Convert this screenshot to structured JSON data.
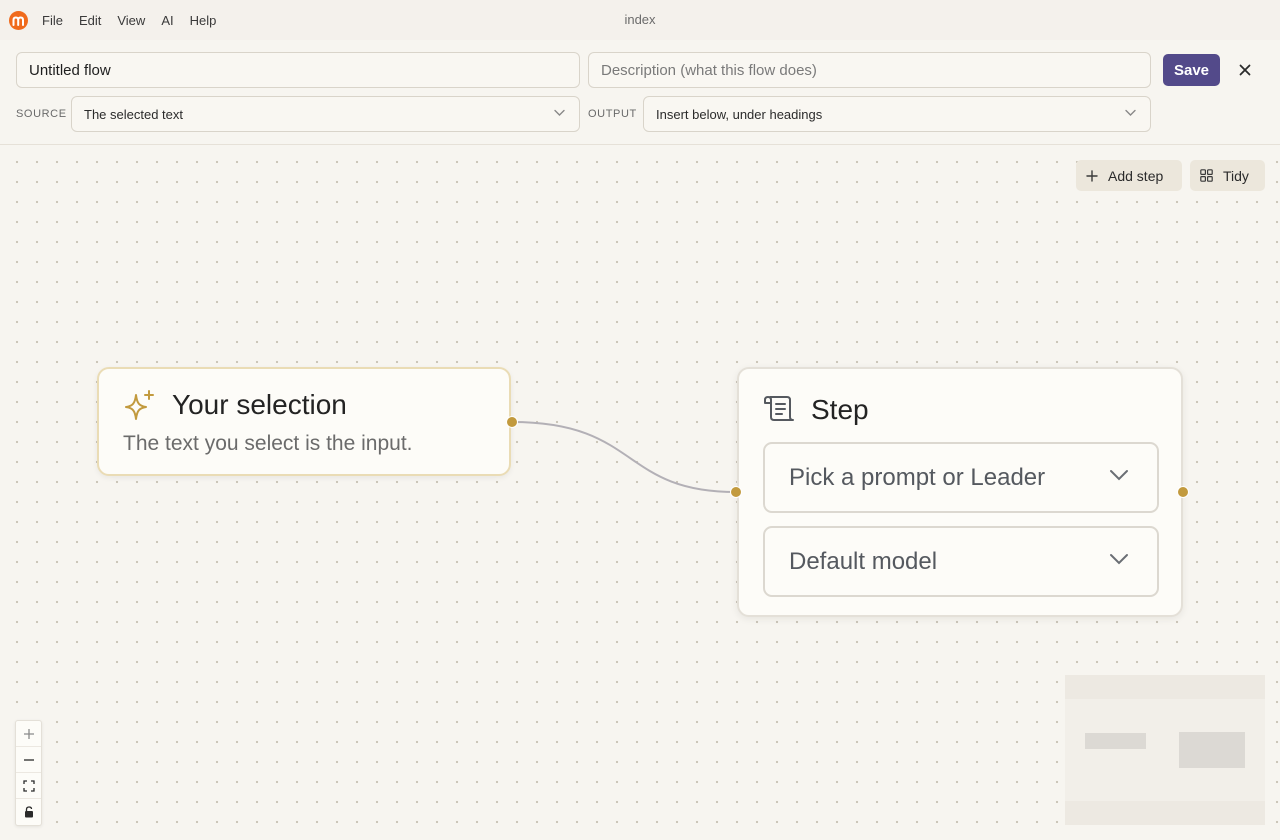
{
  "menubar": {
    "items": [
      "File",
      "Edit",
      "View",
      "AI",
      "Help"
    ],
    "window_title": "index",
    "logo_icon": "m-logo-icon",
    "logo_color": "#f06a1c"
  },
  "form": {
    "title_value": "Untitled flow",
    "description_placeholder": "Description (what this flow does)",
    "save_label": "Save",
    "close_icon": "close-icon",
    "source_label": "SOURCE",
    "source_value": "The selected text",
    "output_label": "OUTPUT",
    "output_value": "Insert below, under headings",
    "accent_color": "#534a8a"
  },
  "toolbar": {
    "add_step_label": "Add step",
    "tidy_label": "Tidy"
  },
  "nodes": {
    "selection": {
      "icon": "sparkles-icon",
      "title": "Your selection",
      "subtitle": "The text you select is the input."
    },
    "step": {
      "icon": "scroll-icon",
      "title": "Step",
      "prompt_placeholder": "Pick a prompt or Leader",
      "model_value": "Default model"
    },
    "handle_color": "#c29a3e"
  },
  "zoom_controls": [
    "zoom-in-icon",
    "zoom-out-icon",
    "fit-view-icon",
    "lock-icon"
  ]
}
